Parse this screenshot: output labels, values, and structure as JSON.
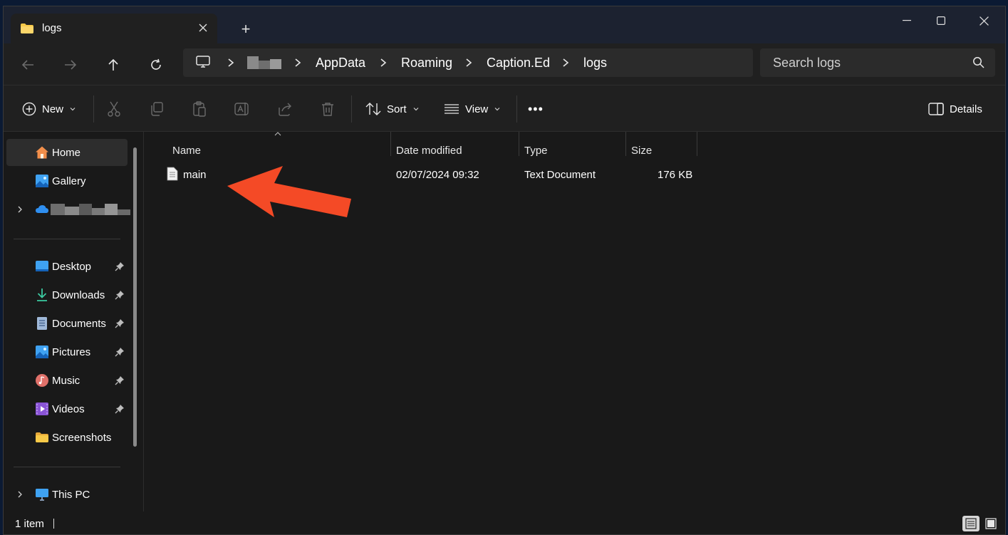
{
  "window": {
    "tab_title": "logs",
    "new_tab_label": "+"
  },
  "address": {
    "breadcrumbs": [
      "AppData",
      "Roaming",
      "Caption.Ed",
      "logs"
    ]
  },
  "search": {
    "placeholder": "Search logs"
  },
  "toolbar": {
    "new_label": "New",
    "sort_label": "Sort",
    "view_label": "View",
    "more_label": "•••",
    "details_label": "Details"
  },
  "sidebar": {
    "home": "Home",
    "gallery": "Gallery",
    "desktop": "Desktop",
    "downloads": "Downloads",
    "documents": "Documents",
    "pictures": "Pictures",
    "music": "Music",
    "videos": "Videos",
    "screenshots": "Screenshots",
    "this_pc": "This PC"
  },
  "columns": {
    "name": "Name",
    "date_modified": "Date modified",
    "type": "Type",
    "size": "Size"
  },
  "files": [
    {
      "name": "main",
      "date_modified": "02/07/2024 09:32",
      "type": "Text Document",
      "size": "176 KB"
    }
  ],
  "status": {
    "item_count": "1 item"
  },
  "colors": {
    "accent_arrow": "#f44a26",
    "folder": "#f7c948",
    "window_bg": "#191919",
    "panel_bg": "#202020"
  },
  "icons": [
    "folder-icon",
    "close-icon",
    "minimize-icon",
    "maximize-icon",
    "back-icon",
    "forward-icon",
    "up-icon",
    "refresh-icon",
    "monitor-icon",
    "search-icon",
    "plus-circle-icon",
    "cut-icon",
    "copy-icon",
    "paste-icon",
    "rename-icon",
    "share-icon",
    "delete-icon",
    "sort-icon",
    "view-icon",
    "details-pane-icon",
    "home-icon",
    "gallery-icon",
    "onedrive-icon",
    "desktop-icon",
    "download-icon",
    "documents-icon",
    "pictures-icon",
    "music-icon",
    "videos-icon",
    "pin-icon",
    "text-file-icon",
    "red-arrow"
  ]
}
